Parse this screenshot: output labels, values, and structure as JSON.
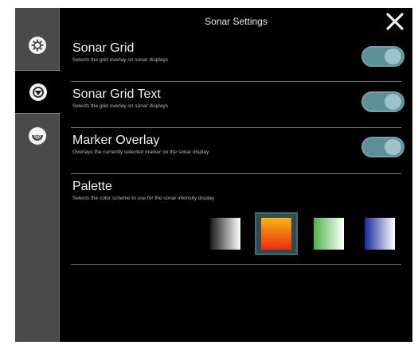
{
  "header": {
    "title": "Sonar Settings"
  },
  "sidebar": {
    "tabs": [
      {
        "icon": "gear-icon",
        "active": false
      },
      {
        "icon": "sonar-icon",
        "active": true
      },
      {
        "icon": "sounder-icon",
        "active": false
      }
    ]
  },
  "settings": [
    {
      "label": "Sonar Grid",
      "description": "Selects the grid overlay on sonar displays",
      "enabled": true
    },
    {
      "label": "Sonar Grid Text",
      "description": "Selects the grid overlay on sonar displays",
      "enabled": true
    },
    {
      "label": "Marker Overlay",
      "description": "Overlays the currently selected marker on the sonar display",
      "enabled": true
    }
  ],
  "palette": {
    "label": "Palette",
    "description": "Selects the color scheme to use for the sonar intensity display",
    "options": [
      {
        "name": "greyscale",
        "colors": [
          "#1a1a1a",
          "#ffffff"
        ]
      },
      {
        "name": "amber",
        "colors": [
          "#f6b414",
          "#ef2b10"
        ]
      },
      {
        "name": "green",
        "colors": [
          "#4fb24c",
          "#ffffff"
        ]
      },
      {
        "name": "blue",
        "colors": [
          "#1c2a9a",
          "#ffffff"
        ]
      }
    ],
    "selected_index": 1
  }
}
